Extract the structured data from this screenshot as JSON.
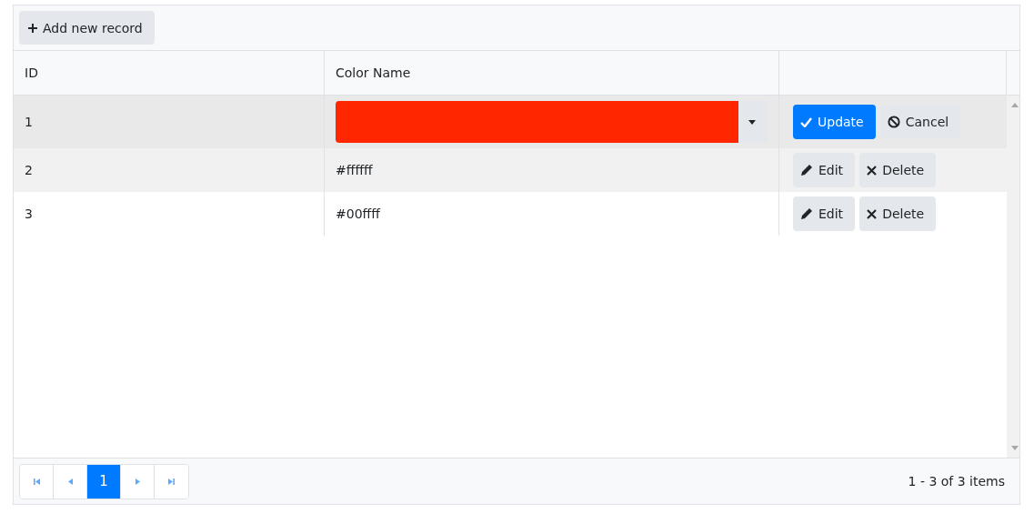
{
  "toolbar": {
    "add_button": "Add new record"
  },
  "table": {
    "columns": [
      "ID",
      "Color Name"
    ],
    "rows": [
      {
        "id": "1",
        "editing": true,
        "highlighted": false,
        "color": "#ff2600",
        "actions": [
          "Update",
          "Cancel"
        ]
      },
      {
        "id": "2",
        "editing": false,
        "highlighted": true,
        "color_name": "#ffffff",
        "actions": [
          "Edit",
          "Delete"
        ]
      },
      {
        "id": "3",
        "editing": false,
        "highlighted": false,
        "color_name": "#00ffff",
        "actions": [
          "Edit",
          "Delete"
        ]
      }
    ]
  },
  "pager": {
    "pages": [
      {
        "label": "1",
        "selected": true
      }
    ],
    "info": "1 - 3 of 3 items"
  }
}
